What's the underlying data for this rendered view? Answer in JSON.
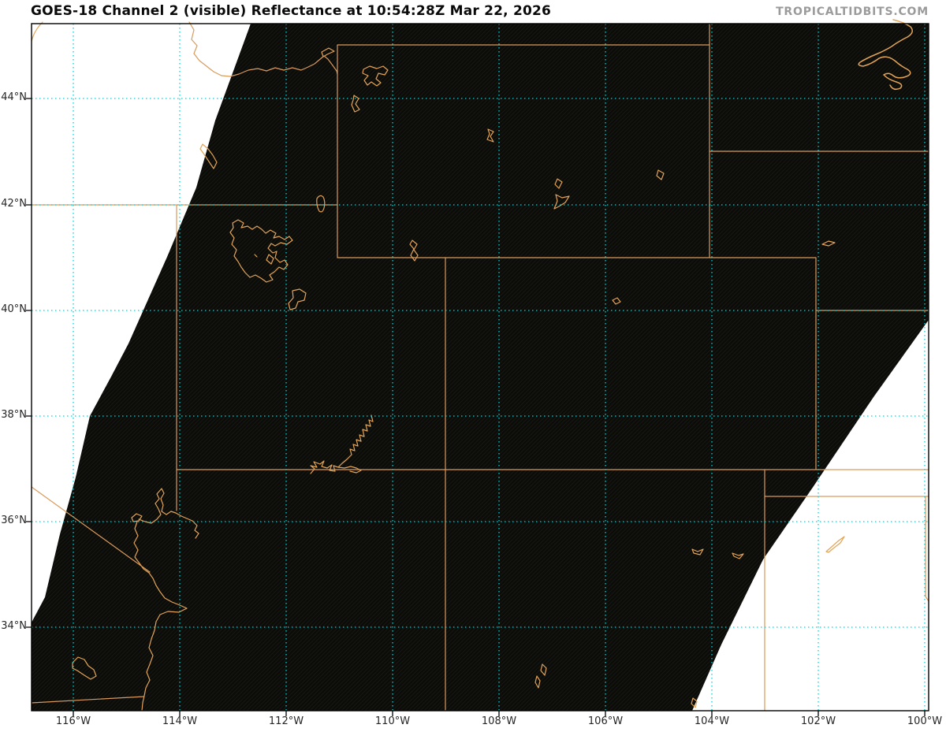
{
  "header": {
    "title": "GOES-18 Channel 2 (visible) Reflectance at 10:54:28Z Mar 22, 2026",
    "watermark": "TROPICALTIDBITS.COM"
  },
  "axes": {
    "lat_ticks": [
      "44°N",
      "42°N",
      "40°N",
      "38°N",
      "36°N",
      "34°N"
    ],
    "lon_ticks": [
      "116°W",
      "114°W",
      "112°W",
      "110°W",
      "108°W",
      "106°W",
      "104°W",
      "102°W",
      "100°W"
    ]
  },
  "colors": {
    "state_border": "#d99a5c",
    "water_outline": "#e3a458",
    "gridline": "#00d4da",
    "swath_black": "#0b0b08",
    "offscan_white": "#ffffff",
    "title_text": "#0a0a0a",
    "watermark_text": "#9b9b9b",
    "tick_text": "#262626"
  }
}
